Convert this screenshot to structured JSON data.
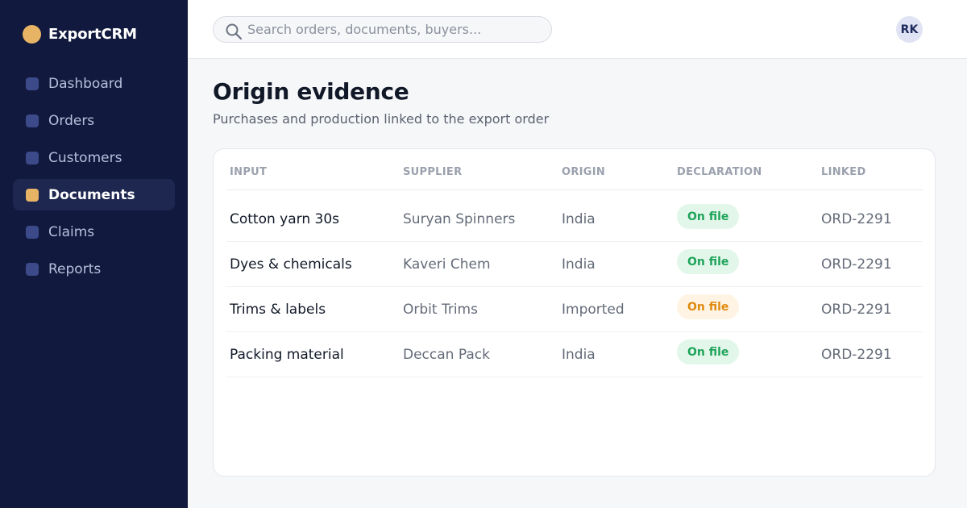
{
  "app": {
    "name": "ExportCRM",
    "brand_color": "#e7b466",
    "sidebar_bg": "#111a3e"
  },
  "sidebar": {
    "items": [
      {
        "label": "Dashboard",
        "icon": "dashboard-icon",
        "active": false
      },
      {
        "label": "Orders",
        "icon": "orders-icon",
        "active": false
      },
      {
        "label": "Customers",
        "icon": "customers-icon",
        "active": false
      },
      {
        "label": "Documents",
        "icon": "documents-icon",
        "active": true
      },
      {
        "label": "Claims",
        "icon": "claims-icon",
        "active": false
      },
      {
        "label": "Reports",
        "icon": "reports-icon",
        "active": false
      }
    ]
  },
  "header": {
    "search": {
      "placeholder": "Search orders, documents, buyers...",
      "value": ""
    },
    "user_initials": "RK"
  },
  "main": {
    "title": "Origin evidence",
    "subtitle": "Purchases and production linked to the export order"
  },
  "table": {
    "columns": [
      "INPUT",
      "SUPPLIER",
      "ORIGIN",
      "DECLARATION",
      "LINKED"
    ],
    "rows": [
      {
        "input": "Cotton yarn 30s",
        "supplier": "Suryan Spinners",
        "origin": "India",
        "declaration": "On file",
        "status": "ok",
        "linked": "ORD-2291"
      },
      {
        "input": "Dyes & chemicals",
        "supplier": "Kaveri Chem",
        "origin": "India",
        "declaration": "On file",
        "status": "ok",
        "linked": "ORD-2291"
      },
      {
        "input": "Trims & labels",
        "supplier": "Orbit Trims",
        "origin": "Imported",
        "declaration": "On file",
        "status": "warn",
        "linked": "ORD-2291"
      },
      {
        "input": "Packing material",
        "supplier": "Deccan Pack",
        "origin": "India",
        "declaration": "On file",
        "status": "ok",
        "linked": "ORD-2291"
      }
    ]
  },
  "status_colors": {
    "ok": "#1fa35a",
    "warn": "#e08a0e"
  }
}
